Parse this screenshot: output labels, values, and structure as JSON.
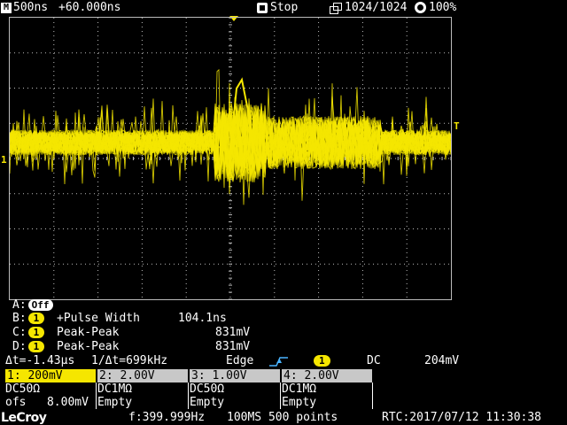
{
  "topbar": {
    "timebase": "500ns",
    "delay": "+60.000ns",
    "run_state": "Stop",
    "acquisition": "1024/1024",
    "intensity": "100%"
  },
  "markers": {
    "channel_marker": "1",
    "trigger_marker": "T"
  },
  "measurements": [
    {
      "slot": "A:",
      "badge": "Off",
      "name": "",
      "value": ""
    },
    {
      "slot": "B:",
      "badge": "1",
      "name": "+Pulse Width",
      "value": "104.1ns"
    },
    {
      "slot": "C:",
      "badge": "1",
      "name": "Peak-Peak",
      "value": "831mV"
    },
    {
      "slot": "D:",
      "badge": "1",
      "name": "Peak-Peak",
      "value": "831mV"
    }
  ],
  "cursor_trigger": {
    "delta_t": "Δt=-1.43µs",
    "inv_delta_t": "1/Δt=699kHz",
    "trigger_type": "Edge",
    "trigger_source": "1",
    "coupling": "DC",
    "level": "204mV"
  },
  "channels": [
    {
      "head": "1: 200mV",
      "coupling": "DC50Ω",
      "extra": "ofs   8.00mV"
    },
    {
      "head": "2: 2.00V",
      "coupling": "DC1MΩ",
      "extra": "Empty"
    },
    {
      "head": "3: 1.00V",
      "coupling": "DC50Ω",
      "extra": "Empty"
    },
    {
      "head": "4: 2.00V",
      "coupling": "DC1MΩ",
      "extra": "Empty"
    }
  ],
  "bottombar": {
    "brand": "LeCroy",
    "frequency": "f:399.999Hz",
    "sample_info": "100MS 500 points",
    "rtc": "RTC:2017/07/12 11:30:38"
  },
  "colors": {
    "trace": "#f5e600",
    "grid": "#bbbbbb",
    "background": "#000000"
  }
}
